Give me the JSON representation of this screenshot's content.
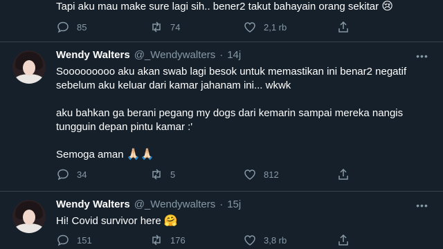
{
  "tweets": [
    {
      "text": "Tapi aku mau make sure lagi sih.. bener2 takut bahayain orang sekitar",
      "emoji": "😢",
      "replies": "85",
      "retweets": "74",
      "likes": "2,1 rb"
    },
    {
      "name": "Wendy Walters",
      "handle": "@_Wendywalters",
      "separator": "·",
      "time": "14j",
      "paragraphs": [
        "Sooooooooo aku akan swab lagi besok untuk memastikan ini benar2 negatif sebelum aku keluar dari kamar jahanam ini... wkwk",
        "aku bahkan ga berani pegang my dogs dari kemarin sampai mereka nangis tungguin depan pintu kamar :'",
        "Semoga aman"
      ],
      "emoji": "🙏🏻🙏🏻",
      "replies": "34",
      "retweets": "5",
      "likes": "812"
    },
    {
      "name": "Wendy Walters",
      "handle": "@_Wendywalters",
      "separator": "·",
      "time": "15j",
      "text": "Hi! Covid survivor here",
      "emoji": "🤗",
      "replies": "151",
      "retweets": "176",
      "likes": "3,8 rb"
    }
  ],
  "icons": {
    "reply": "reply-icon",
    "retweet": "retweet-icon",
    "like": "heart-icon",
    "share": "share-icon",
    "more": "more-icon"
  },
  "colors": {
    "background": "#15202b",
    "muted": "#8899a6",
    "divider": "#38444d"
  }
}
